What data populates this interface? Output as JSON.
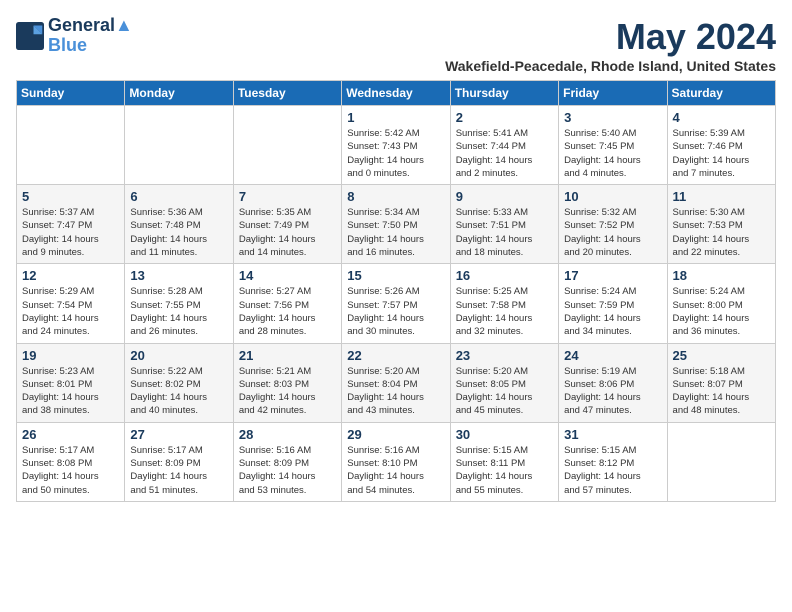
{
  "logo": {
    "line1": "General",
    "line2": "Blue"
  },
  "title": "May 2024",
  "location": "Wakefield-Peacedale, Rhode Island, United States",
  "days_of_week": [
    "Sunday",
    "Monday",
    "Tuesday",
    "Wednesday",
    "Thursday",
    "Friday",
    "Saturday"
  ],
  "weeks": [
    [
      {
        "day": "",
        "details": ""
      },
      {
        "day": "",
        "details": ""
      },
      {
        "day": "",
        "details": ""
      },
      {
        "day": "1",
        "details": "Sunrise: 5:42 AM\nSunset: 7:43 PM\nDaylight: 14 hours\nand 0 minutes."
      },
      {
        "day": "2",
        "details": "Sunrise: 5:41 AM\nSunset: 7:44 PM\nDaylight: 14 hours\nand 2 minutes."
      },
      {
        "day": "3",
        "details": "Sunrise: 5:40 AM\nSunset: 7:45 PM\nDaylight: 14 hours\nand 4 minutes."
      },
      {
        "day": "4",
        "details": "Sunrise: 5:39 AM\nSunset: 7:46 PM\nDaylight: 14 hours\nand 7 minutes."
      }
    ],
    [
      {
        "day": "5",
        "details": "Sunrise: 5:37 AM\nSunset: 7:47 PM\nDaylight: 14 hours\nand 9 minutes."
      },
      {
        "day": "6",
        "details": "Sunrise: 5:36 AM\nSunset: 7:48 PM\nDaylight: 14 hours\nand 11 minutes."
      },
      {
        "day": "7",
        "details": "Sunrise: 5:35 AM\nSunset: 7:49 PM\nDaylight: 14 hours\nand 14 minutes."
      },
      {
        "day": "8",
        "details": "Sunrise: 5:34 AM\nSunset: 7:50 PM\nDaylight: 14 hours\nand 16 minutes."
      },
      {
        "day": "9",
        "details": "Sunrise: 5:33 AM\nSunset: 7:51 PM\nDaylight: 14 hours\nand 18 minutes."
      },
      {
        "day": "10",
        "details": "Sunrise: 5:32 AM\nSunset: 7:52 PM\nDaylight: 14 hours\nand 20 minutes."
      },
      {
        "day": "11",
        "details": "Sunrise: 5:30 AM\nSunset: 7:53 PM\nDaylight: 14 hours\nand 22 minutes."
      }
    ],
    [
      {
        "day": "12",
        "details": "Sunrise: 5:29 AM\nSunset: 7:54 PM\nDaylight: 14 hours\nand 24 minutes."
      },
      {
        "day": "13",
        "details": "Sunrise: 5:28 AM\nSunset: 7:55 PM\nDaylight: 14 hours\nand 26 minutes."
      },
      {
        "day": "14",
        "details": "Sunrise: 5:27 AM\nSunset: 7:56 PM\nDaylight: 14 hours\nand 28 minutes."
      },
      {
        "day": "15",
        "details": "Sunrise: 5:26 AM\nSunset: 7:57 PM\nDaylight: 14 hours\nand 30 minutes."
      },
      {
        "day": "16",
        "details": "Sunrise: 5:25 AM\nSunset: 7:58 PM\nDaylight: 14 hours\nand 32 minutes."
      },
      {
        "day": "17",
        "details": "Sunrise: 5:24 AM\nSunset: 7:59 PM\nDaylight: 14 hours\nand 34 minutes."
      },
      {
        "day": "18",
        "details": "Sunrise: 5:24 AM\nSunset: 8:00 PM\nDaylight: 14 hours\nand 36 minutes."
      }
    ],
    [
      {
        "day": "19",
        "details": "Sunrise: 5:23 AM\nSunset: 8:01 PM\nDaylight: 14 hours\nand 38 minutes."
      },
      {
        "day": "20",
        "details": "Sunrise: 5:22 AM\nSunset: 8:02 PM\nDaylight: 14 hours\nand 40 minutes."
      },
      {
        "day": "21",
        "details": "Sunrise: 5:21 AM\nSunset: 8:03 PM\nDaylight: 14 hours\nand 42 minutes."
      },
      {
        "day": "22",
        "details": "Sunrise: 5:20 AM\nSunset: 8:04 PM\nDaylight: 14 hours\nand 43 minutes."
      },
      {
        "day": "23",
        "details": "Sunrise: 5:20 AM\nSunset: 8:05 PM\nDaylight: 14 hours\nand 45 minutes."
      },
      {
        "day": "24",
        "details": "Sunrise: 5:19 AM\nSunset: 8:06 PM\nDaylight: 14 hours\nand 47 minutes."
      },
      {
        "day": "25",
        "details": "Sunrise: 5:18 AM\nSunset: 8:07 PM\nDaylight: 14 hours\nand 48 minutes."
      }
    ],
    [
      {
        "day": "26",
        "details": "Sunrise: 5:17 AM\nSunset: 8:08 PM\nDaylight: 14 hours\nand 50 minutes."
      },
      {
        "day": "27",
        "details": "Sunrise: 5:17 AM\nSunset: 8:09 PM\nDaylight: 14 hours\nand 51 minutes."
      },
      {
        "day": "28",
        "details": "Sunrise: 5:16 AM\nSunset: 8:09 PM\nDaylight: 14 hours\nand 53 minutes."
      },
      {
        "day": "29",
        "details": "Sunrise: 5:16 AM\nSunset: 8:10 PM\nDaylight: 14 hours\nand 54 minutes."
      },
      {
        "day": "30",
        "details": "Sunrise: 5:15 AM\nSunset: 8:11 PM\nDaylight: 14 hours\nand 55 minutes."
      },
      {
        "day": "31",
        "details": "Sunrise: 5:15 AM\nSunset: 8:12 PM\nDaylight: 14 hours\nand 57 minutes."
      },
      {
        "day": "",
        "details": ""
      }
    ]
  ]
}
